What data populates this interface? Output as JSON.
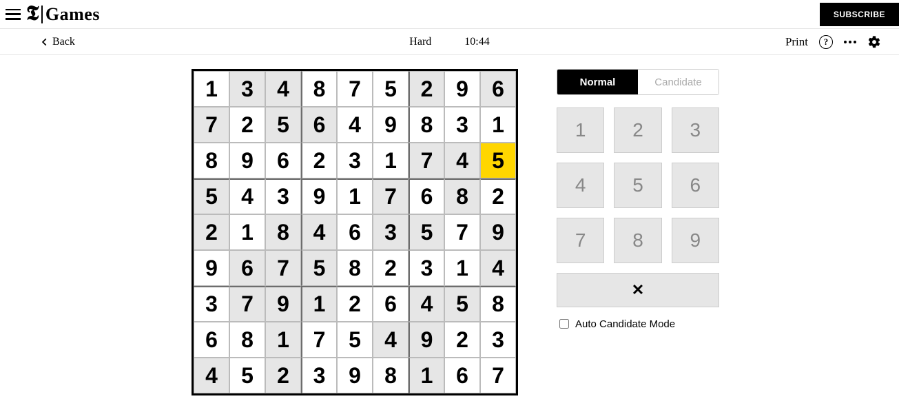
{
  "header": {
    "brand_t": "𝕿",
    "brand_word": "Games",
    "subscribe": "SUBSCRIBE"
  },
  "toolbar": {
    "back": "Back",
    "difficulty": "Hard",
    "timer": "10:44",
    "print": "Print",
    "help": "?"
  },
  "sudoku": {
    "grid": [
      [
        1,
        3,
        4,
        8,
        7,
        5,
        2,
        9,
        6
      ],
      [
        7,
        2,
        5,
        6,
        4,
        9,
        8,
        3,
        1
      ],
      [
        8,
        9,
        6,
        2,
        3,
        1,
        7,
        4,
        5
      ],
      [
        5,
        4,
        3,
        9,
        1,
        7,
        6,
        8,
        2
      ],
      [
        2,
        1,
        8,
        4,
        6,
        3,
        5,
        7,
        9
      ],
      [
        9,
        6,
        7,
        5,
        8,
        2,
        3,
        1,
        4
      ],
      [
        3,
        7,
        9,
        1,
        2,
        6,
        4,
        5,
        8
      ],
      [
        6,
        8,
        1,
        7,
        5,
        4,
        9,
        2,
        3
      ],
      [
        4,
        5,
        2,
        3,
        9,
        8,
        1,
        6,
        7
      ]
    ],
    "shaded": [
      [
        0,
        1
      ],
      [
        0,
        2
      ],
      [
        0,
        6
      ],
      [
        0,
        8
      ],
      [
        1,
        0
      ],
      [
        1,
        2
      ],
      [
        1,
        3
      ],
      [
        2,
        6
      ],
      [
        2,
        7
      ],
      [
        3,
        0
      ],
      [
        3,
        5
      ],
      [
        3,
        7
      ],
      [
        4,
        0
      ],
      [
        4,
        2
      ],
      [
        4,
        3
      ],
      [
        4,
        5
      ],
      [
        4,
        6
      ],
      [
        4,
        8
      ],
      [
        5,
        1
      ],
      [
        5,
        2
      ],
      [
        5,
        3
      ],
      [
        5,
        8
      ],
      [
        6,
        1
      ],
      [
        6,
        2
      ],
      [
        6,
        3
      ],
      [
        6,
        6
      ],
      [
        6,
        7
      ],
      [
        7,
        2
      ],
      [
        7,
        5
      ],
      [
        7,
        6
      ],
      [
        8,
        0
      ],
      [
        8,
        2
      ],
      [
        8,
        6
      ]
    ],
    "selected": [
      2,
      8
    ]
  },
  "panel": {
    "mode_normal": "Normal",
    "mode_candidate": "Candidate",
    "keys": [
      "1",
      "2",
      "3",
      "4",
      "5",
      "6",
      "7",
      "8",
      "9"
    ],
    "clear": "✕",
    "auto_label": "Auto Candidate Mode"
  }
}
